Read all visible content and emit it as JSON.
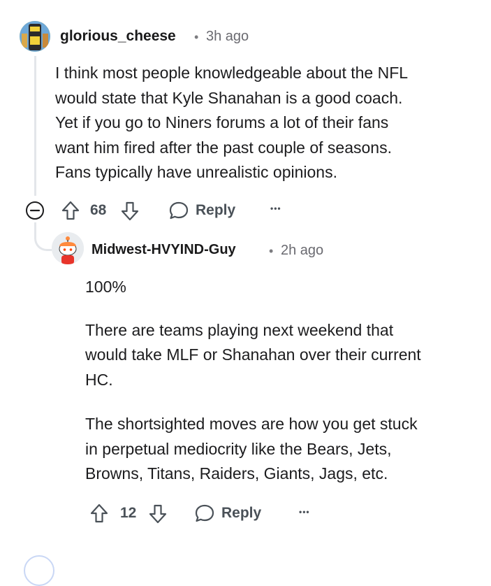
{
  "comment": {
    "username": "glorious_cheese",
    "separator": "•",
    "time": "3h ago",
    "body": [
      "I think most people knowledgeable about the NFL",
      "would state that Kyle Shanahan is a good coach.",
      "Yet if you go to Niners forums a lot of their fans",
      "want him fired after the past couple of seasons.",
      "Fans typically have unrealistic opinions."
    ],
    "score": "68",
    "reply_label": "Reply",
    "more_label": "•••"
  },
  "reply": {
    "username": "Midwest-HVYIND-Guy",
    "separator": "•",
    "time": "2h ago",
    "body": [
      "100%",
      "There are teams playing next weekend that",
      "would take MLF or Shanahan over their current",
      "HC.",
      "The shortsighted moves are how you get stuck",
      "in perpetual mediocrity like the Bears, Jets,",
      "Browns, Titans, Raiders, Giants, Jags, etc."
    ],
    "score": "12",
    "reply_label": "Reply",
    "more_label": "•••"
  },
  "colors": {
    "action_gray": "#4a5158",
    "thread_line": "#e3e6ea",
    "avatar1_bg": "#e8d63a"
  },
  "icons": [
    "collapse-icon",
    "upvote-icon",
    "downvote-icon",
    "reply-bubble-icon",
    "more-options-icon"
  ]
}
